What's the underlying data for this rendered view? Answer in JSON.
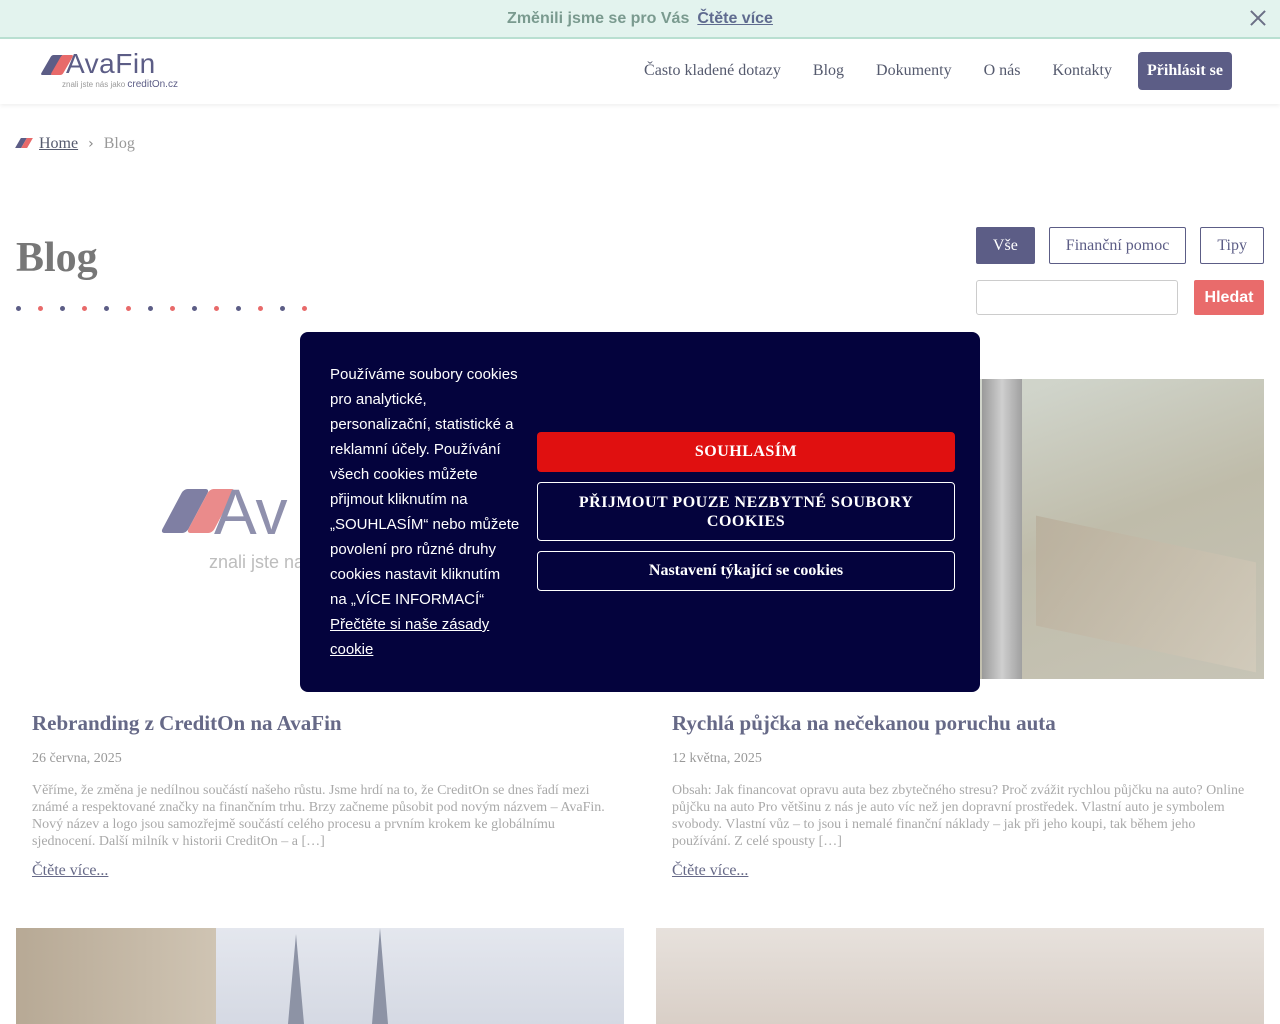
{
  "banner": {
    "text": "Změnili jsme se pro Vás",
    "link": "Čtěte více"
  },
  "header": {
    "logo_name": "AvaFin",
    "logo_tag_prefix": "znali jste nás jako",
    "logo_tag_brand": "creditOn.cz",
    "nav": [
      "Často kladené dotazy",
      "Blog",
      "Dokumenty",
      "O nás",
      "Kontakty"
    ],
    "login": "Přihlásit se"
  },
  "breadcrumb": {
    "home": "Home",
    "current": "Blog"
  },
  "page": {
    "title": "Blog"
  },
  "filters": {
    "items": [
      "Vše",
      "Finanční pomoc",
      "Tipy"
    ],
    "search_button": "Hledat",
    "search_placeholder": ""
  },
  "cards": [
    {
      "title": "Rebranding z CreditOn na AvaFin",
      "date": "26 června, 2025",
      "excerpt": "Věříme, že změna je nedílnou součástí našeho růstu. Jsme hrdí na to, že CreditOn se dnes řadí mezi známé a respektované značky na finančním trhu. Brzy začneme působit pod novým názvem – AvaFin. Nový název a logo jsou samozřejmě součástí celého procesu a prvním krokem ke globálnímu sjednocení. Další milník v historii CreditOn – a […]",
      "more": "Čtěte více...",
      "image_logo": "Av",
      "image_tag": "znali jste na"
    },
    {
      "title": "Rychlá půjčka na nečekanou poruchu auta",
      "date": "12 května, 2025",
      "excerpt": "Obsah: Jak financovat opravu auta bez zbytečného stresu? Proč zvážit rychlou půjčku na auto? Online půjčku na auto Pro většinu z nás je auto víc než jen dopravní prostředek. Vlastní auto je symbolem svobody. Vlastní vůz – to jsou i nemalé finanční náklady – jak při jeho koupi, tak během jeho používání. Z celé spousty […]",
      "more": "Čtěte více..."
    }
  ],
  "cookie": {
    "text": "Používáme soubory cookies pro analytické, personalizační, statistické a reklamní účely. Používání všech cookies můžete přijmout kliknutím na „SOUHLASÍM“ nebo můžete povolení pro různé druhy cookies nastavit kliknutím na „VÍCE INFORMACÍ“",
    "policy_link": "Přečtěte si naše zásady cookie",
    "accept": "SOUHLASÍM",
    "necessary": "PŘIJMOUT POUZE NEZBYTNÉ SOUBORY COOKIES",
    "settings": "Nastavení týkající se cookies"
  },
  "colors": {
    "primary": "#5c5d86",
    "accent": "#e86a6a",
    "cookie_bg": "#04033d",
    "accept_red": "#e01010",
    "banner_bg": "#e3f3ee"
  }
}
